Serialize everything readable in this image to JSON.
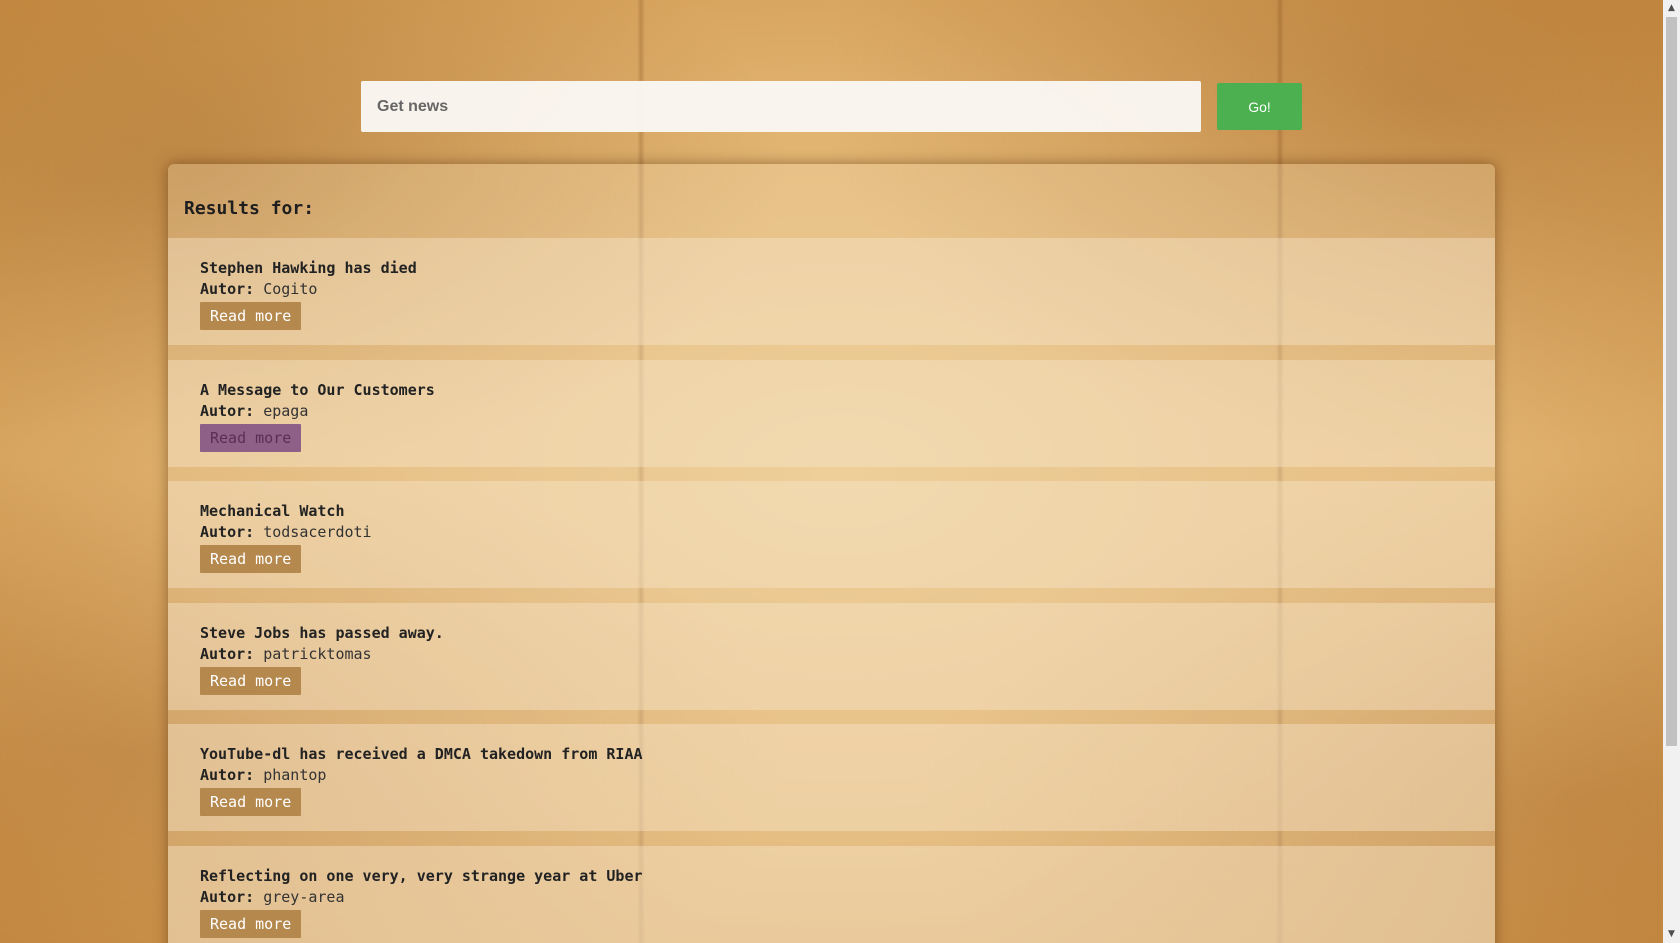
{
  "search": {
    "placeholder": "Get news",
    "button_label": "Go!"
  },
  "results": {
    "heading": "Results for:",
    "author_label": "Autor:",
    "read_more_label": "Read more",
    "items": [
      {
        "title": "Stephen Hawking has died",
        "author": "Cogito",
        "visited": false
      },
      {
        "title": "A Message to Our Customers",
        "author": "epaga",
        "visited": true
      },
      {
        "title": "Mechanical Watch",
        "author": "todsacerdoti",
        "visited": false
      },
      {
        "title": "Steve Jobs has passed away.",
        "author": "patricktomas",
        "visited": false
      },
      {
        "title": "YouTube-dl has received a DMCA takedown from RIAA",
        "author": "phantop",
        "visited": false
      },
      {
        "title": "Reflecting on one very, very strange year at Uber",
        "author": "grey-area",
        "visited": false
      }
    ]
  },
  "scrollbar": {
    "up_icon": "▲",
    "down_icon": "▼"
  },
  "colors": {
    "go_button": "#4caf50",
    "read_more": "#b5884e",
    "read_more_visited": "#8e5f87"
  }
}
